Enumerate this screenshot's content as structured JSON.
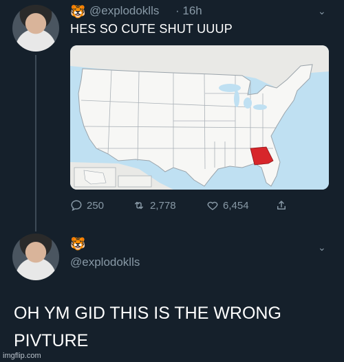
{
  "tweet1": {
    "handle": "@explodoklls",
    "time": "· 16h",
    "text": "HES SO CUTE SHUT UUUP",
    "emoji": "🐯",
    "stats": {
      "replies": "250",
      "retweets": "2,778",
      "likes": "6,454"
    }
  },
  "tweet2": {
    "handle": "@explodoklls",
    "emoji": "🐯",
    "text_line1": "OH YM GID THIS IS THE WRONG",
    "text_line2": "PIVTURE"
  },
  "watermark": "imgflip.com",
  "colors": {
    "background": "#15202b",
    "map_land": "#f7f7f5",
    "map_water": "#bfe0f2",
    "highlight": "#d7262b"
  }
}
